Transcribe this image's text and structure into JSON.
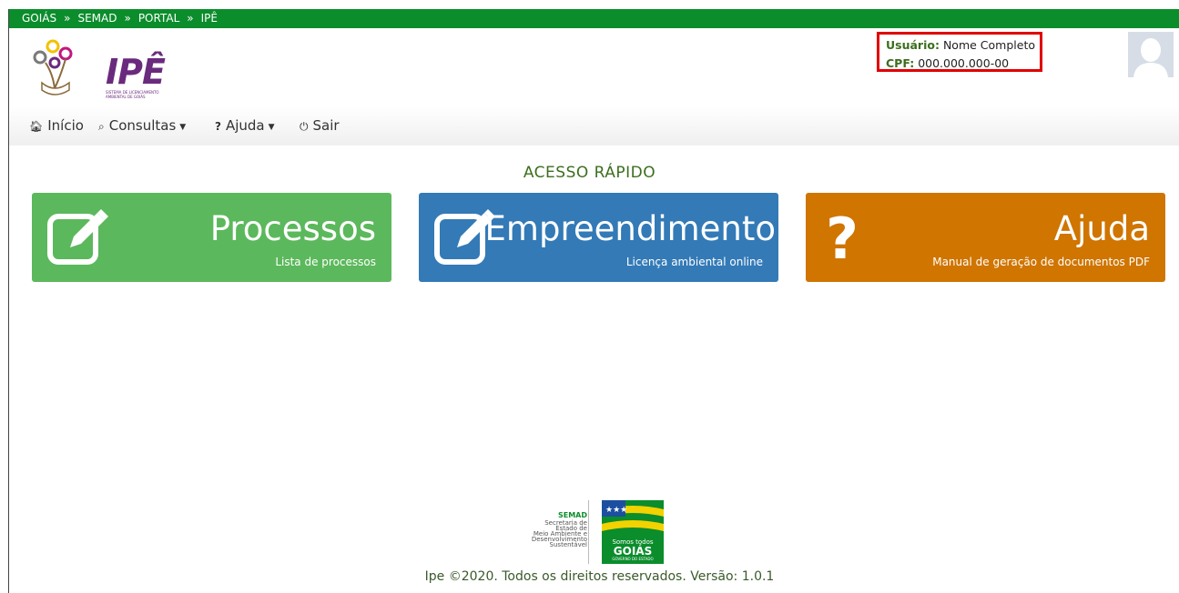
{
  "breadcrumb": [
    "GOIÁS",
    "SEMAD",
    "PORTAL",
    "IPÊ"
  ],
  "breadcrumb_sep": "»",
  "logo": {
    "name": "IPÊ",
    "subtitle": "SISTEMA DE LICENCIAMENTO AMBIENTAL DE GOIÁS"
  },
  "user": {
    "user_label": "Usuário:",
    "user_value": "Nome Completo",
    "cpf_label": "CPF:",
    "cpf_value": "000.000.000-00"
  },
  "nav": [
    {
      "label": "Início",
      "icon": "home-icon"
    },
    {
      "label": "Consultas",
      "icon": "search-icon"
    },
    {
      "label": "Ajuda",
      "icon": "question-icon"
    },
    {
      "label": "Sair",
      "icon": "power-icon"
    }
  ],
  "section_title": "ACESSO RÁPIDO",
  "tiles": [
    {
      "title": "Processos",
      "subtitle": "Lista de processos",
      "icon": "edit-icon",
      "color": "#5cb85c"
    },
    {
      "title": "Empreendimento",
      "subtitle": "Licença ambiental online",
      "icon": "edit-icon",
      "color": "#337ab7"
    },
    {
      "title": "Ajuda",
      "subtitle": "Manual de geração de documentos PDF",
      "icon": "question-icon",
      "color": "#cf7500"
    }
  ],
  "footer": {
    "semad": {
      "name": "SEMAD",
      "lines": [
        "Secretaria de",
        "Estado de",
        "Meio Ambiente e",
        "Desenvolvimento",
        "Sustentável"
      ]
    },
    "gov": {
      "line1": "Somos todos",
      "line2": "GOIÁS",
      "line3": "GOVERNO DO ESTADO"
    },
    "copyright": "Ipe ©2020. Todos os direitos reservados. Versão: 1.0.1"
  },
  "colors": {
    "topbar": "#0b8d2c",
    "accent_text": "#3c6e1e",
    "highlight_border": "#e00000"
  }
}
